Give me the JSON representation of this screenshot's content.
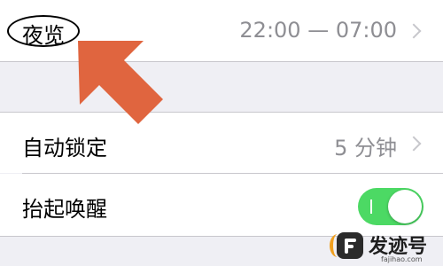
{
  "settings": {
    "night_shift": {
      "label": "夜览",
      "value": "22:00 — 07:00"
    },
    "auto_lock": {
      "label": "自动锁定",
      "value": "5 分钟"
    },
    "raise_to_wake": {
      "label": "抬起唤醒",
      "enabled": true
    }
  },
  "annotation": {
    "arrow_color": "#e0653f",
    "highlight": "oval-outline"
  },
  "colors": {
    "toggle_on": "#4cd964",
    "background": "#efeff4",
    "secondary_text": "#8e8e93"
  },
  "watermark": {
    "title": "发迹号",
    "url": "fajihao.com"
  }
}
